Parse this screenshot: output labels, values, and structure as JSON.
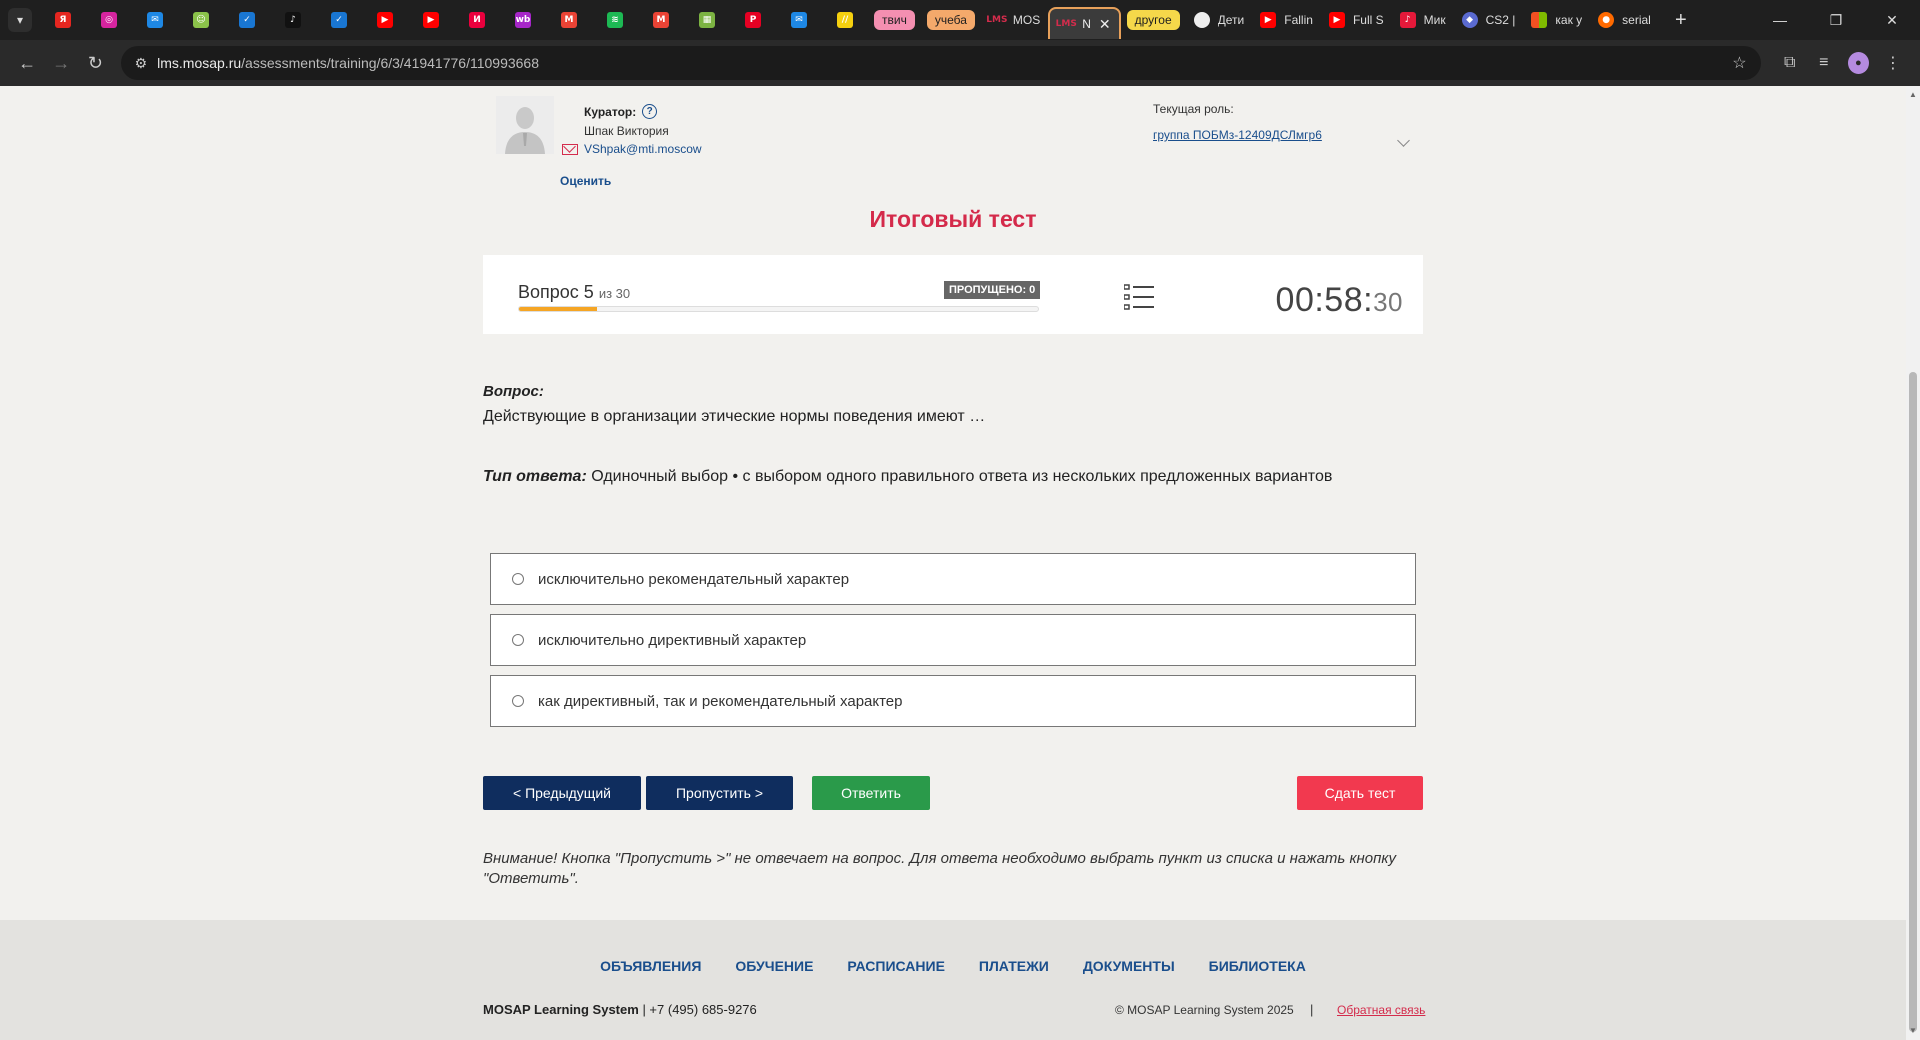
{
  "browser": {
    "tabs_pinned": [
      {
        "icon": "yandex-icon",
        "color": "#e52620"
      },
      {
        "icon": "instagram-icon",
        "color": "#d6249f"
      },
      {
        "icon": "messages-icon",
        "color": "#1e88e5"
      },
      {
        "icon": "android-icon",
        "color": "#8bc34a"
      },
      {
        "icon": "check-icon",
        "color": "#1976d2"
      },
      {
        "icon": "tiktok-icon",
        "color": "#111111"
      },
      {
        "icon": "check-icon",
        "color": "#1976d2"
      },
      {
        "icon": "youtube-icon",
        "color": "#ff0000"
      },
      {
        "icon": "youtube-icon",
        "color": "#ff0000"
      },
      {
        "icon": "ivi-icon",
        "color": "#ea003d"
      },
      {
        "icon": "wildberries-icon",
        "color": "#a626c8"
      },
      {
        "icon": "gmail-icon",
        "color": "#ea4335"
      },
      {
        "icon": "spotify-icon",
        "color": "#1db954"
      },
      {
        "icon": "gmail-icon",
        "color": "#ea4335"
      },
      {
        "icon": "colors-icon",
        "color": "#7cb342"
      },
      {
        "icon": "pinterest-icon",
        "color": "#e60023"
      },
      {
        "icon": "mail-icon",
        "color": "#1e88e5"
      },
      {
        "icon": "lines-icon",
        "color": "#f6d10f"
      }
    ],
    "group_twitch": {
      "label": "твич",
      "color": "#f48fb1"
    },
    "group_study": {
      "label": "учеба",
      "color": "#f4a96b"
    },
    "tab_mos": {
      "title": "MOS"
    },
    "tab_active": {
      "title": "N"
    },
    "group_other": {
      "label": "другое",
      "color": "#f5d84a"
    },
    "tab_deti": {
      "title": "Дети"
    },
    "tab_fallin": {
      "title": "Fallin"
    },
    "tab_full": {
      "title": "Full S"
    },
    "tab_mik": {
      "title": "Мик"
    },
    "tab_cs2": {
      "title": "CS2 |"
    },
    "tab_kak": {
      "title": "как у"
    },
    "tab_serial": {
      "title": "serial"
    },
    "url_domain": "lms.mosap.ru",
    "url_path": "/assessments/training/6/3/41941776/110993668"
  },
  "curator": {
    "label": "Куратор:",
    "name": "Шпак Виктория",
    "email": "VShpak@mti.moscow",
    "rate_link": "Оценить"
  },
  "role": {
    "label": "Текущая роль:",
    "value": "группа ПОБМз-12409ДСЛмгр6"
  },
  "test": {
    "title": "Итоговый тест",
    "question_label": "Вопрос 5",
    "question_of": "из 30",
    "current": 5,
    "total": 30,
    "skipped": "ПРОПУЩЕНО: 0",
    "timer_main": "00:58:",
    "timer_sec": "30"
  },
  "question": {
    "heading": "Вопрос:",
    "text": "Действующие в организации этические нормы поведения имеют …",
    "answer_type_label": "Тип ответа:",
    "answer_type_value": "Одиночный выбор • с выбором одного правильного ответа из нескольких предложенных вариантов",
    "options": [
      "исключительно рекомендательный характер",
      "исключительно директивный характер",
      "как директивный, так и рекомендательный характер"
    ]
  },
  "buttons": {
    "prev": "< Предыдущий",
    "skip": "Пропустить >",
    "answer": "Ответить",
    "submit": "Сдать тест"
  },
  "notice": "Внимание! Кнопка \"Пропустить >\" не отвечает на вопрос. Для ответа необходимо выбрать пункт из списка и нажать кнопку \"Ответить\".",
  "footer": {
    "nav": [
      "ОБЪЯВЛЕНИЯ",
      "ОБУЧЕНИЕ",
      "РАСПИСАНИЕ",
      "ПЛАТЕЖИ",
      "ДОКУМЕНТЫ",
      "БИБЛИОТЕКА"
    ],
    "brand": "MOSAP Learning System",
    "phone": "| +7 (495) 685-9276",
    "copyright": "© MOSAP Learning System 2025",
    "separator": "|",
    "feedback": "Обратная связь"
  },
  "colors": {
    "accent_red": "#d42a4a",
    "navy": "#0f2d5e",
    "green": "#2a9a4a",
    "submit_red": "#f2394f",
    "progress": "#f5a524"
  }
}
